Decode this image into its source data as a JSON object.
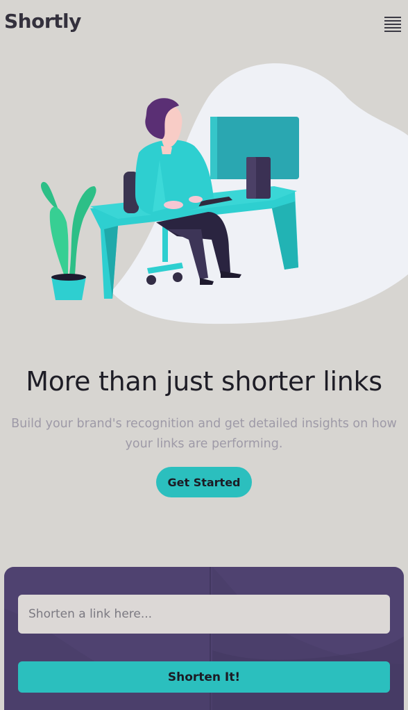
{
  "header": {
    "logo": "Shortly",
    "menu_icon": "hamburger-menu-icon"
  },
  "hero": {
    "illustration": "person-working-at-desk-illustration",
    "title": "More than just shorter links",
    "description": "Build your brand's recognition and get detailed insights on how your links are performing.",
    "cta_label": "Get Started"
  },
  "shortener": {
    "input_placeholder": "Shorten a link here...",
    "input_value": "",
    "button_label": "Shorten It!"
  },
  "colors": {
    "accent": "#2bbfbe",
    "panel": "#4b3f6b",
    "background": "#d7d5d1",
    "heading": "#1e1d26",
    "muted_text": "#9e9aa7"
  }
}
